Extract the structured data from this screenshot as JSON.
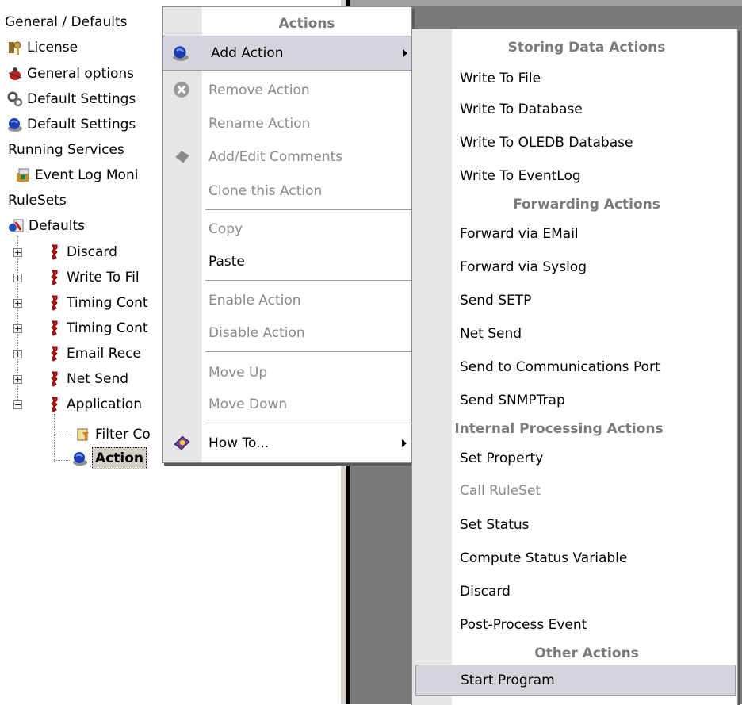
{
  "tree": {
    "items": [
      {
        "label": "General / Defaults",
        "icon": "none"
      },
      {
        "label": "License",
        "icon": "license-key-icon"
      },
      {
        "label": "General options",
        "icon": "bug-icon"
      },
      {
        "label": "Default Settings",
        "icon": "gear-icon"
      },
      {
        "label": "Default Settings",
        "icon": "globe-icon"
      },
      {
        "label": "Running Services",
        "icon": "none"
      },
      {
        "label": "Event Log Moni",
        "icon": "event-log-icon"
      },
      {
        "label": "RuleSets",
        "icon": "none"
      },
      {
        "label": "Defaults",
        "icon": "ruleset-icon"
      },
      {
        "label": "Discard",
        "icon": "rule-icon"
      },
      {
        "label": "Write To Fil",
        "icon": "rule-icon"
      },
      {
        "label": "Timing Cont",
        "icon": "rule-icon"
      },
      {
        "label": "Timing Cont",
        "icon": "rule-icon"
      },
      {
        "label": "Email Rece",
        "icon": "rule-icon"
      },
      {
        "label": "Net Send",
        "icon": "rule-icon"
      },
      {
        "label": "Application",
        "icon": "rule-icon"
      },
      {
        "label": "Filter Co",
        "icon": "filter-icon"
      },
      {
        "label": "Action",
        "icon": "globe-icon"
      }
    ]
  },
  "context_menu": {
    "header": "Actions",
    "items": [
      {
        "label": "Add Action",
        "enabled": true,
        "submenu": true,
        "icon": "globe-icon"
      },
      {
        "label": "Remove Action",
        "enabled": false,
        "icon": "remove-icon"
      },
      {
        "label": "Rename Action",
        "enabled": false
      },
      {
        "label": "Add/Edit Comments",
        "enabled": false,
        "icon": "comment-icon"
      },
      {
        "label": "Clone this Action",
        "enabled": false
      },
      {
        "label": "Copy",
        "enabled": false
      },
      {
        "label": "Paste",
        "enabled": true
      },
      {
        "label": "Enable Action",
        "enabled": false
      },
      {
        "label": "Disable Action",
        "enabled": false
      },
      {
        "label": "Move Up",
        "enabled": false
      },
      {
        "label": "Move Down",
        "enabled": false
      },
      {
        "label": "How To...",
        "enabled": true,
        "submenu": true,
        "icon": "help-book-icon"
      }
    ]
  },
  "submenu": {
    "sections": [
      {
        "header": "Storing Data Actions",
        "items": [
          "Write To File",
          "Write To Database",
          "Write To OLEDB Database",
          "Write To EventLog"
        ]
      },
      {
        "header": "Forwarding Actions",
        "items": [
          "Forward via EMail",
          "Forward via Syslog",
          "Send SETP",
          "Net Send",
          "Send to Communications Port",
          "Send SNMPTrap"
        ]
      },
      {
        "header": "Internal Processing Actions",
        "items": [
          "Set Property",
          "Call RuleSet",
          "Set Status",
          "Compute Status Variable",
          "Discard",
          "Post-Process Event"
        ]
      },
      {
        "header": "Other Actions",
        "items": [
          "Start Program"
        ]
      }
    ],
    "disabled_items": [
      "Call RuleSet"
    ],
    "highlighted_item": "Start Program"
  },
  "colors": {
    "menu_gutter": "#e6e6e6",
    "header_text": "#7a7a7a",
    "highlight": "#d4d4dc",
    "pane_dark": "#7a7a7a"
  }
}
